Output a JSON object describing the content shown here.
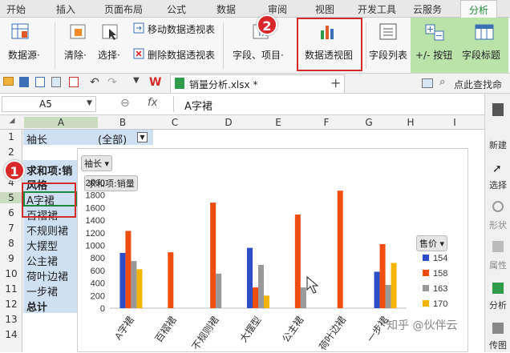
{
  "tabs": [
    "开始",
    "插入",
    "页面布局",
    "公式",
    "数据",
    "审阅",
    "视图",
    "开发工具",
    "云服务",
    "分析"
  ],
  "ribbon": {
    "datasource": "数据源·",
    "clear": "清除·",
    "select": "选择·",
    "move_pivot": "移动数据透视表",
    "delete_pivot": "删除数据透视表",
    "field_item": "字段、项目·",
    "pivot_chart": "数据透视图",
    "field_list": "字段列表",
    "plus_minus": "+/- 按钮",
    "field_title": "字段标题"
  },
  "quickbar": {
    "file_tab": "销量分析.xlsx *",
    "search": "点此查找命令"
  },
  "formula": {
    "namebox": "A5",
    "fx": "fx",
    "content": "A字裙"
  },
  "columns": [
    "A",
    "B",
    "C",
    "D",
    "E",
    "F",
    "G",
    "H",
    "I"
  ],
  "rows": [
    "1",
    "2",
    "3",
    "4",
    "5",
    "6",
    "7",
    "8",
    "9",
    "10",
    "11",
    "12",
    "13",
    "14"
  ],
  "cells": {
    "a1": "袖长",
    "b1": "(全部)",
    "a3": "求和项:销",
    "a4": "风格",
    "a5": "A字裙",
    "a6": "百褶裙",
    "a7": "不规则裙",
    "a8": "大摆型",
    "a9": "公主裙",
    "a10": "荷叶边裙",
    "a11": "一步裙",
    "a12": "总计"
  },
  "right_panel": [
    "新建",
    "选择",
    "形状",
    "属性",
    "分析",
    "传图"
  ],
  "badges": [
    "1",
    "2"
  ],
  "colors": {
    "accent": "#1e8a3c",
    "highlight": "#d32a2a"
  },
  "chart_data": {
    "type": "bar",
    "filter_chip": "袖长",
    "value_chip": "求和项:销量",
    "legend_title": "售价",
    "categories": [
      "A字裙",
      "百褶裙",
      "不规则裙",
      "大摆型",
      "公主裙",
      "荷叶边裙",
      "一步裙"
    ],
    "ylim": [
      0,
      2000
    ],
    "yticks": [
      "0",
      "200",
      "400",
      "600",
      "800",
      "1000",
      "1200",
      "1400",
      "1600",
      "1800",
      "2000"
    ],
    "series": [
      {
        "name": "154",
        "color": "#2c4ec9",
        "values": [
          880,
          0,
          0,
          960,
          0,
          0,
          580
        ]
      },
      {
        "name": "158",
        "color": "#f04e11",
        "values": [
          1230,
          890,
          1680,
          330,
          1490,
          1870,
          1020
        ]
      },
      {
        "name": "163",
        "color": "#999999",
        "values": [
          750,
          0,
          550,
          690,
          330,
          0,
          370
        ]
      },
      {
        "name": "170",
        "color": "#f5b400",
        "values": [
          620,
          0,
          0,
          200,
          0,
          0,
          720
        ]
      }
    ]
  },
  "watermark": "知乎 @伙伴云"
}
